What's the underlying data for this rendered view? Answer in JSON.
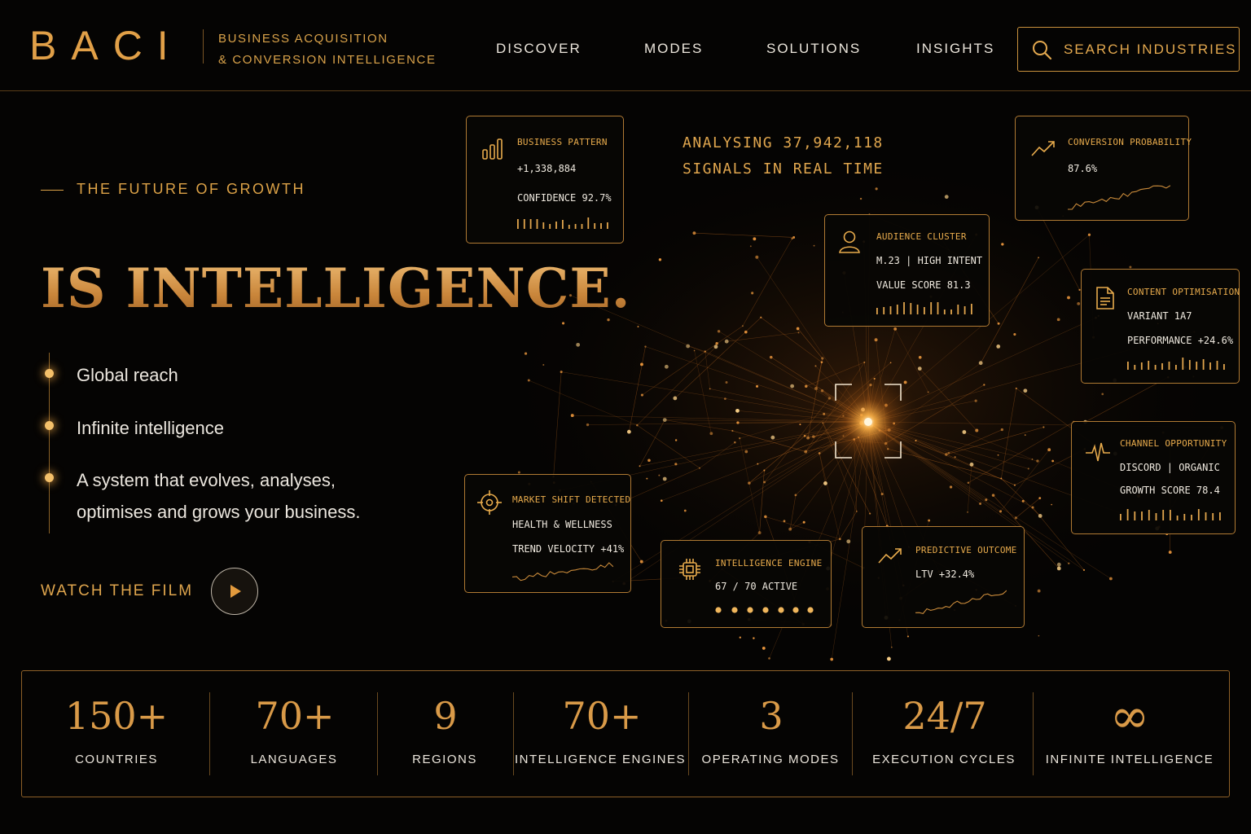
{
  "brand": {
    "logo": "BACI",
    "tagline_line1": "BUSINESS ACQUISITION",
    "tagline_line2": "& CONVERSION INTELLIGENCE"
  },
  "nav": {
    "items": [
      "DISCOVER",
      "MODES",
      "SOLUTIONS",
      "INSIGHTS"
    ],
    "search_label": "SEARCH INDUSTRIES",
    "search_icon": "search-icon"
  },
  "hero": {
    "kicker": "THE FUTURE OF GROWTH",
    "headline": "IS INTELLIGENCE.",
    "bullets": [
      [
        "Global reach"
      ],
      [
        "Infinite intelligence"
      ],
      [
        "A system that evolves, analyses,",
        "optimises and grows your business."
      ]
    ],
    "watch_label": "WATCH THE FILM",
    "play_icon": "play-icon"
  },
  "analysing": {
    "line1": "ANALYSING 37,942,118",
    "line2": "SIGNALS IN REAL TIME"
  },
  "cards": [
    {
      "id": "business-pattern",
      "icon": "bar-chart-icon",
      "title": "BUSINESS PATTERN",
      "lines": [
        "+1,338,884",
        "CONFIDENCE 92.7%"
      ],
      "viz": "bars"
    },
    {
      "id": "conversion-probability",
      "icon": "trend-up-icon",
      "title": "CONVERSION PROBABILITY",
      "lines": [
        "87.6%"
      ],
      "viz": "spark"
    },
    {
      "id": "audience-cluster",
      "icon": "user-icon",
      "title": "AUDIENCE CLUSTER",
      "lines": [
        "M.23 | HIGH INTENT",
        "VALUE SCORE 81.3"
      ],
      "viz": "bars"
    },
    {
      "id": "content-optimisation",
      "icon": "document-icon",
      "title": "CONTENT OPTIMISATION",
      "lines": [
        "VARIANT 1A7",
        "PERFORMANCE +24.6%"
      ],
      "viz": "bars"
    },
    {
      "id": "channel-opportunity",
      "icon": "pulse-icon",
      "title": "CHANNEL OPPORTUNITY",
      "lines": [
        "DISCORD | ORGANIC",
        "GROWTH SCORE 78.4"
      ],
      "viz": "bars"
    },
    {
      "id": "market-shift",
      "icon": "crosshair-icon",
      "title": "MARKET SHIFT DETECTED",
      "lines": [
        "HEALTH & WELLNESS",
        "TREND VELOCITY +41%"
      ],
      "viz": "spark"
    },
    {
      "id": "intelligence-engine",
      "icon": "chip-icon",
      "title": "INTELLIGENCE ENGINE",
      "lines": [
        "67 / 70 ACTIVE"
      ],
      "viz": "dots"
    },
    {
      "id": "predictive-outcome",
      "icon": "trend-up-icon",
      "title": "PREDICTIVE OUTCOME",
      "lines": [
        "LTV +32.4%"
      ],
      "viz": "spark"
    }
  ],
  "stats": [
    {
      "value": "150+",
      "label": "COUNTRIES"
    },
    {
      "value": "70+",
      "label": "LANGUAGES"
    },
    {
      "value": "9",
      "label": "REGIONS"
    },
    {
      "value": "70+",
      "label": "INTELLIGENCE ENGINES"
    },
    {
      "value": "3",
      "label": "OPERATING MODES"
    },
    {
      "value": "24/7",
      "label": "EXECUTION CYCLES"
    },
    {
      "value": "∞",
      "label": "INFINITE INTELLIGENCE"
    }
  ],
  "colors": {
    "accent": "#d99a48",
    "background": "#050403",
    "text": "#ece6dc"
  }
}
